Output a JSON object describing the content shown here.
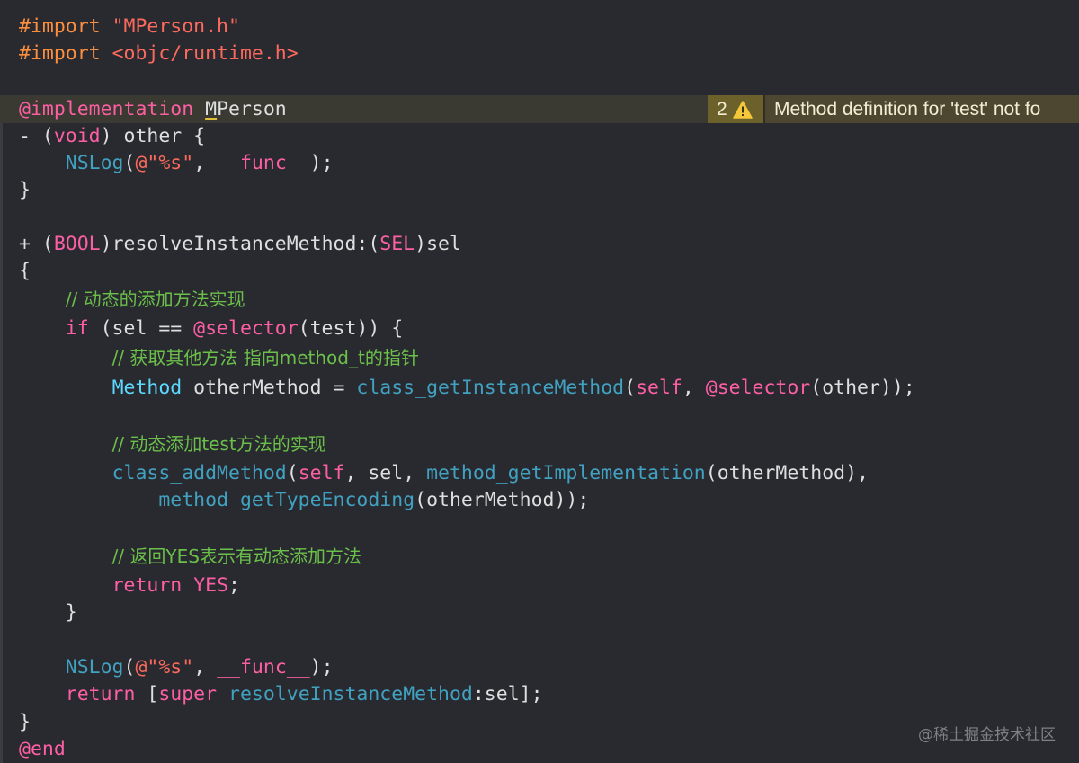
{
  "colors": {
    "background": "#292a30",
    "plain": "#dfdfe0",
    "keyword": "#fc5fa3",
    "string": "#fc6a5d",
    "preprocessor": "#fd8f3f",
    "type": "#5dd8ff",
    "function": "#41a1c0",
    "comment": "#6bc04a",
    "warning_badge": "#6d612b",
    "warning_bg": "#4d4732"
  },
  "warning": {
    "count": "2",
    "icon": "warning-triangle-icon",
    "message": "Method definition for 'test' not fo"
  },
  "watermark": "@稀土掘金技术社区",
  "lines": [
    {
      "hl": false,
      "tokens": [
        {
          "t": "#import",
          "k": "preprocessor"
        },
        {
          "t": " ",
          "k": "plain"
        },
        {
          "t": "\"MPerson.h\"",
          "k": "string"
        }
      ]
    },
    {
      "hl": false,
      "tokens": [
        {
          "t": "#import",
          "k": "preprocessor"
        },
        {
          "t": " ",
          "k": "plain"
        },
        {
          "t": "<objc/runtime.h>",
          "k": "string"
        }
      ]
    },
    {
      "hl": false,
      "tokens": []
    },
    {
      "hl": true,
      "tokens": [
        {
          "t": "@implementation",
          "k": "keyword"
        },
        {
          "t": " ",
          "k": "plain"
        },
        {
          "t": "M",
          "k": "plain",
          "u": true
        },
        {
          "t": "Person",
          "k": "plain"
        }
      ]
    },
    {
      "hl": false,
      "tokens": [
        {
          "t": "- (",
          "k": "plain"
        },
        {
          "t": "void",
          "k": "keyword"
        },
        {
          "t": ") other {",
          "k": "plain"
        }
      ]
    },
    {
      "hl": false,
      "tokens": [
        {
          "t": "    ",
          "k": "plain"
        },
        {
          "t": "NSLog",
          "k": "function"
        },
        {
          "t": "(",
          "k": "plain"
        },
        {
          "t": "@\"%s\"",
          "k": "string"
        },
        {
          "t": ", ",
          "k": "plain"
        },
        {
          "t": "__func__",
          "k": "keyword"
        },
        {
          "t": ");",
          "k": "plain"
        }
      ]
    },
    {
      "hl": false,
      "tokens": [
        {
          "t": "}",
          "k": "plain"
        }
      ]
    },
    {
      "hl": false,
      "tokens": []
    },
    {
      "hl": false,
      "tokens": [
        {
          "t": "+ (",
          "k": "plain"
        },
        {
          "t": "BOOL",
          "k": "keyword"
        },
        {
          "t": ")resolveInstanceMethod:(",
          "k": "plain"
        },
        {
          "t": "SEL",
          "k": "keyword"
        },
        {
          "t": ")sel",
          "k": "plain"
        }
      ]
    },
    {
      "hl": false,
      "tokens": [
        {
          "t": "{",
          "k": "plain"
        }
      ]
    },
    {
      "hl": false,
      "tokens": [
        {
          "t": "    ",
          "k": "plain"
        },
        {
          "t": "// 动态的添加方法实现",
          "k": "comment",
          "c": true
        }
      ]
    },
    {
      "hl": false,
      "tokens": [
        {
          "t": "    ",
          "k": "plain"
        },
        {
          "t": "if",
          "k": "keyword"
        },
        {
          "t": " (sel == ",
          "k": "plain"
        },
        {
          "t": "@selector",
          "k": "keyword"
        },
        {
          "t": "(test)) {",
          "k": "plain"
        }
      ]
    },
    {
      "hl": false,
      "tokens": [
        {
          "t": "        ",
          "k": "plain"
        },
        {
          "t": "// 获取其他方法 指向method_t的指针",
          "k": "comment",
          "c": true
        }
      ]
    },
    {
      "hl": false,
      "tokens": [
        {
          "t": "        ",
          "k": "plain"
        },
        {
          "t": "Method",
          "k": "type"
        },
        {
          "t": " otherMethod = ",
          "k": "plain"
        },
        {
          "t": "class_getInstanceMethod",
          "k": "function"
        },
        {
          "t": "(",
          "k": "plain"
        },
        {
          "t": "self",
          "k": "keyword"
        },
        {
          "t": ", ",
          "k": "plain"
        },
        {
          "t": "@selector",
          "k": "keyword"
        },
        {
          "t": "(other));",
          "k": "plain"
        }
      ]
    },
    {
      "hl": false,
      "tokens": []
    },
    {
      "hl": false,
      "tokens": [
        {
          "t": "        ",
          "k": "plain"
        },
        {
          "t": "// 动态添加test方法的实现",
          "k": "comment",
          "c": true
        }
      ]
    },
    {
      "hl": false,
      "tokens": [
        {
          "t": "        ",
          "k": "plain"
        },
        {
          "t": "class_addMethod",
          "k": "function"
        },
        {
          "t": "(",
          "k": "plain"
        },
        {
          "t": "self",
          "k": "keyword"
        },
        {
          "t": ", sel, ",
          "k": "plain"
        },
        {
          "t": "method_getImplementation",
          "k": "function"
        },
        {
          "t": "(otherMethod),",
          "k": "plain"
        }
      ]
    },
    {
      "hl": false,
      "tokens": [
        {
          "t": "            ",
          "k": "plain"
        },
        {
          "t": "method_getTypeEncoding",
          "k": "function"
        },
        {
          "t": "(otherMethod));",
          "k": "plain"
        }
      ]
    },
    {
      "hl": false,
      "tokens": []
    },
    {
      "hl": false,
      "tokens": [
        {
          "t": "        ",
          "k": "plain"
        },
        {
          "t": "// 返回YES表示有动态添加方法",
          "k": "comment",
          "c": true
        }
      ]
    },
    {
      "hl": false,
      "tokens": [
        {
          "t": "        ",
          "k": "plain"
        },
        {
          "t": "return",
          "k": "keyword"
        },
        {
          "t": " ",
          "k": "plain"
        },
        {
          "t": "YES",
          "k": "keyword"
        },
        {
          "t": ";",
          "k": "plain"
        }
      ]
    },
    {
      "hl": false,
      "tokens": [
        {
          "t": "    }",
          "k": "plain"
        }
      ]
    },
    {
      "hl": false,
      "tokens": []
    },
    {
      "hl": false,
      "tokens": [
        {
          "t": "    ",
          "k": "plain"
        },
        {
          "t": "NSLog",
          "k": "function"
        },
        {
          "t": "(",
          "k": "plain"
        },
        {
          "t": "@\"%s\"",
          "k": "string"
        },
        {
          "t": ", ",
          "k": "plain"
        },
        {
          "t": "__func__",
          "k": "keyword"
        },
        {
          "t": ");",
          "k": "plain"
        }
      ]
    },
    {
      "hl": false,
      "tokens": [
        {
          "t": "    ",
          "k": "plain"
        },
        {
          "t": "return",
          "k": "keyword"
        },
        {
          "t": " [",
          "k": "plain"
        },
        {
          "t": "super",
          "k": "keyword"
        },
        {
          "t": " ",
          "k": "plain"
        },
        {
          "t": "resolveInstanceMethod",
          "k": "function"
        },
        {
          "t": ":sel];",
          "k": "plain"
        }
      ]
    },
    {
      "hl": false,
      "tokens": [
        {
          "t": "}",
          "k": "plain"
        }
      ]
    },
    {
      "hl": false,
      "tokens": [
        {
          "t": "@end",
          "k": "keyword"
        }
      ]
    }
  ]
}
